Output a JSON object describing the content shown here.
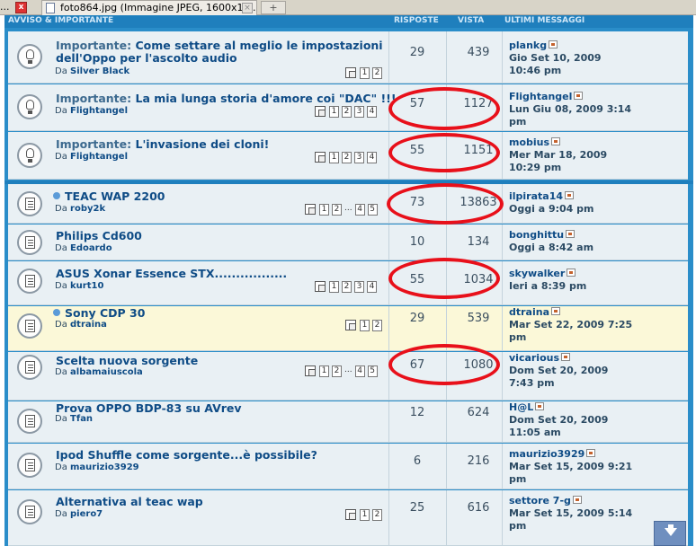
{
  "browser": {
    "left_dots": "...",
    "close_label": "x",
    "tab_title": "foto864.jpg (Immagine JPEG, 1600x12...",
    "tab_close": "×",
    "new_tab": "+"
  },
  "header": {
    "col_topic": "AVVISO & IMPORTANTE",
    "col_replies": "RISPOSTE",
    "col_views": "VISTA",
    "col_last": "ULTIMI MESSAGGI"
  },
  "topics": [
    {
      "prefix": "Importante:",
      "title": "Come settare al meglio le impostazioni",
      "title2": "dell'Oppo per l'ascolto audio",
      "by_label": "Da",
      "author": "Silver Black",
      "pages": [
        "1",
        "2"
      ],
      "replies": "29",
      "views": "439",
      "last_user": "plankg",
      "last_date1": "Gio Set 10, 2009",
      "last_date2": "10:46 pm"
    },
    {
      "prefix": "Importante:",
      "title": "La mia lunga storia d'amore coi \"DAC\" !!!",
      "by_label": "Da",
      "author": "Flightangel",
      "pages": [
        "1",
        "2",
        "3",
        "4"
      ],
      "replies": "57",
      "views": "1127",
      "last_user": "Flightangel",
      "last_date1": "Lun Giu 08, 2009 3:14",
      "last_date2": "pm"
    },
    {
      "prefix": "Importante:",
      "title": "L'invasione dei cloni!",
      "by_label": "Da",
      "author": "Flightangel",
      "pages": [
        "1",
        "2",
        "3",
        "4"
      ],
      "replies": "55",
      "views": "1151",
      "last_user": "mobius",
      "last_date1": "Mer Mar 18, 2009",
      "last_date2": "10:29 pm"
    },
    {
      "title": "TEAC WAP 2200",
      "by_label": "Da",
      "author": "roby2k",
      "pages": [
        "1",
        "2",
        "...",
        "4",
        "5"
      ],
      "replies": "73",
      "views": "13863",
      "last_user": "ilpirata14",
      "last_date1": "Oggi a 9:04 pm"
    },
    {
      "title": "Philips Cd600",
      "by_label": "Da",
      "author": "Edoardo",
      "replies": "10",
      "views": "134",
      "last_user": "bonghittu",
      "last_date1": "Oggi a 8:42 am"
    },
    {
      "title": "ASUS Xonar Essence STX.................",
      "by_label": "Da",
      "author": "kurt10",
      "pages": [
        "1",
        "2",
        "3",
        "4"
      ],
      "replies": "55",
      "views": "1034",
      "last_user": "skywalker",
      "last_date1": "Ieri a 8:39 pm"
    },
    {
      "title": "Sony CDP 30",
      "by_label": "Da",
      "author": "dtraina",
      "pages": [
        "1",
        "2"
      ],
      "replies": "29",
      "views": "539",
      "last_user": "dtraina",
      "last_date1": "Mar Set 22, 2009 7:25",
      "last_date2": "pm"
    },
    {
      "title": "Scelta nuova sorgente",
      "by_label": "Da",
      "author": "albamaiuscola",
      "pages": [
        "1",
        "2",
        "...",
        "4",
        "5"
      ],
      "replies": "67",
      "views": "1080",
      "last_user": "vicarious",
      "last_date1": "Dom Set 20, 2009",
      "last_date2": "7:43 pm"
    },
    {
      "title": "Prova OPPO BDP-83 su AVrev",
      "by_label": "Da",
      "author": "Tfan",
      "replies": "12",
      "views": "624",
      "last_user": "H@L",
      "last_date1": "Dom Set 20, 2009",
      "last_date2": "11:05 am"
    },
    {
      "title": "Ipod Shuffle come sorgente...è possibile?",
      "by_label": "Da",
      "author": "maurizio3929",
      "replies": "6",
      "views": "216",
      "last_user": "maurizio3929",
      "last_date1": "Mar Set 15, 2009 9:21",
      "last_date2": "pm"
    },
    {
      "title": "Alternativa al teac wap",
      "by_label": "Da",
      "author": "piero7",
      "pages": [
        "1",
        "2"
      ],
      "replies": "25",
      "views": "616",
      "last_user": "settore 7-g",
      "last_date1": "Mar Set 15, 2009 5:14",
      "last_date2": "pm"
    }
  ],
  "colors": {
    "frame": "#2a8dc9",
    "row": "#e9f0f4",
    "highlight_row": "#fbf8d8",
    "link": "#0f4c86",
    "annotation_ring": "#e8101a"
  },
  "icons": {
    "announcement": "lightbulb-icon",
    "topic": "topic-document-icon",
    "multipage": "multipage-icon",
    "last_post": "last-post-arrow-icon",
    "scroll": "scroll-down-icon"
  }
}
